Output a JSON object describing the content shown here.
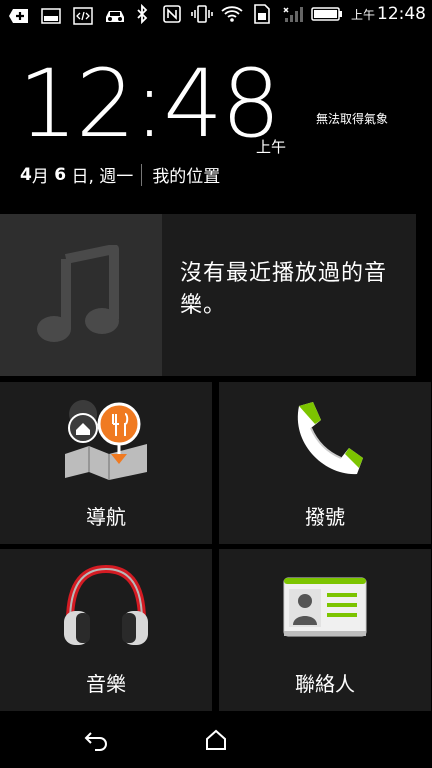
{
  "status_bar": {
    "time_ampm": "上午",
    "time": "12:48",
    "left_icons": [
      "add-notification-icon",
      "image-icon",
      "code-icon",
      "car-icon"
    ],
    "right_icons": [
      "bluetooth-icon",
      "nfc-icon",
      "vibrate-icon",
      "wifi-icon",
      "sim-icon",
      "signal-icon",
      "battery-icon"
    ]
  },
  "clock": {
    "time": "12:48",
    "ampm": "上午",
    "weather": "無法取得氣象",
    "date_month": "4",
    "date_month_unit": "月",
    "date_day": "6",
    "date_day_unit": "日, 週一",
    "location": "我的位置"
  },
  "music_card": {
    "message": "沒有最近播放過的音樂。"
  },
  "tiles": [
    {
      "label": "導航",
      "icon": "navigation-map-icon"
    },
    {
      "label": "撥號",
      "icon": "phone-icon"
    },
    {
      "label": "音樂",
      "icon": "headphones-icon"
    },
    {
      "label": "聯絡人",
      "icon": "contacts-card-icon"
    }
  ],
  "colors": {
    "background": "#000000",
    "tile": "#1c1c1c",
    "accent_orange": "#f07a21",
    "accent_green": "#7cc400",
    "headphone_red": "#d41b23"
  }
}
